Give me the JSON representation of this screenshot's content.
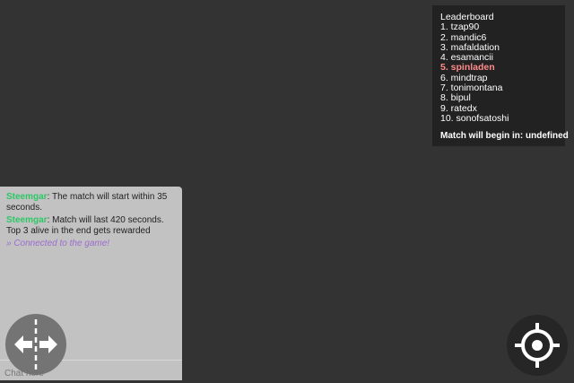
{
  "leaderboard": {
    "title": "Leaderboard",
    "entries": [
      "1. tzap90",
      "2. mandic6",
      "3. mafaldation",
      "4. esamancii",
      "5. spinladen",
      "6. mindtrap",
      "7. tonimontana",
      "8. bipul",
      "9. ratedx",
      "10. sonofsatoshi"
    ],
    "highlight_color": "#ff8a8a",
    "countdown": "Match will begin in: undefined"
  },
  "chat": {
    "messages": [
      {
        "sender": "Steemgar",
        "text": ": The match will start within 35 seconds."
      },
      {
        "sender": "Steemgar",
        "text": ": Match will last 420 seconds. Top 3 alive in the end gets rewarded"
      }
    ],
    "system_message": "» Connected to the game!",
    "input_placeholder": "Chat here",
    "sender_color": "#2ec766",
    "system_color": "#9c6bd0"
  },
  "controls": {
    "split_icon": "split-arrows-icon",
    "target_icon": "crosshair-icon"
  }
}
